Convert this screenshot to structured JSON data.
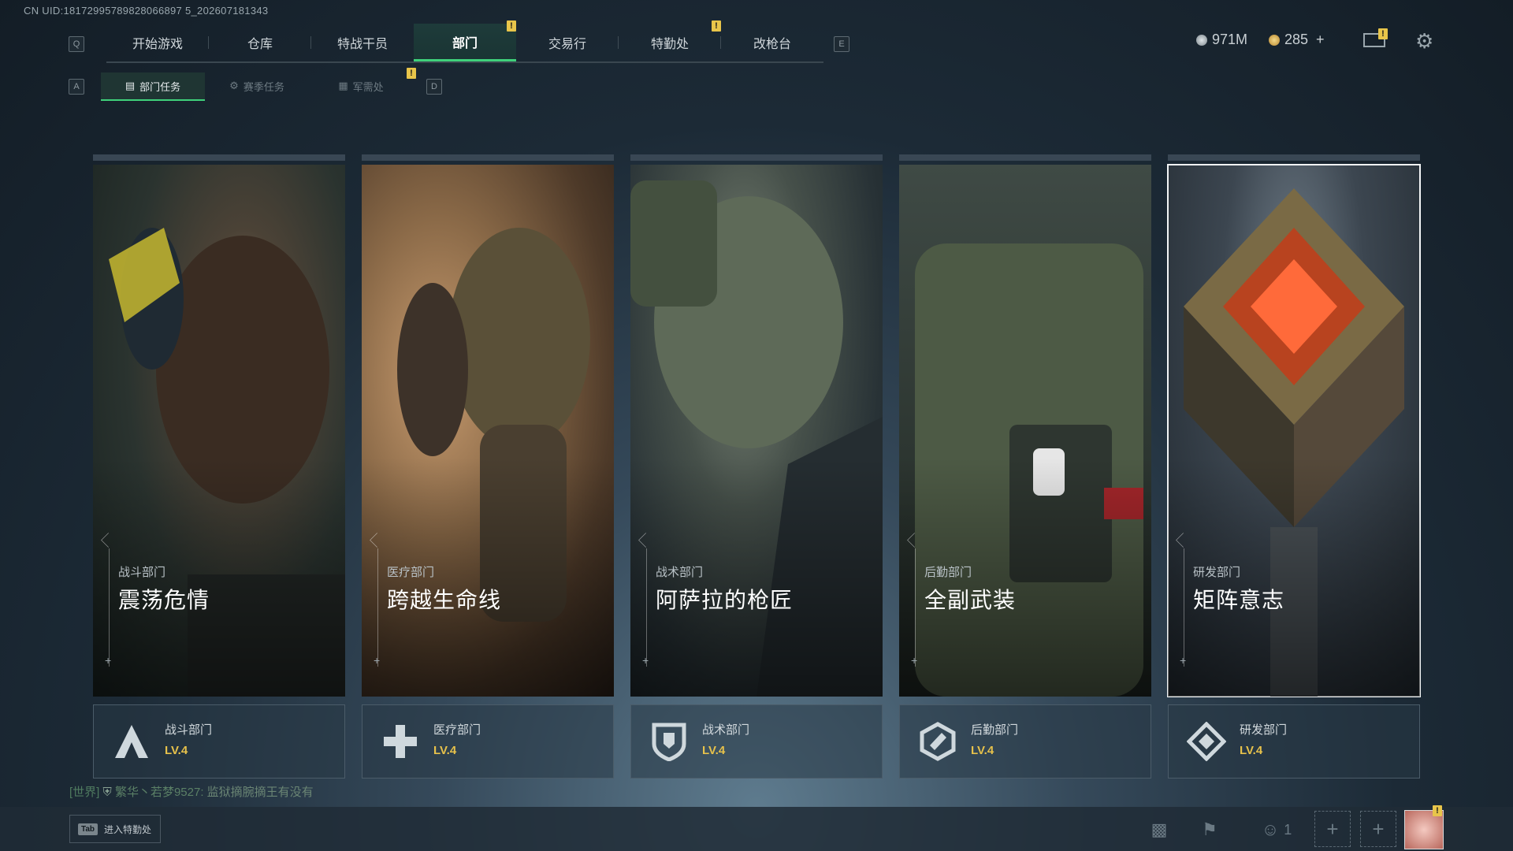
{
  "uid": "CN UID:18172995789828066897 5_202607181343",
  "nav": {
    "left_key": "Q",
    "right_key": "E",
    "tabs": [
      "开始游戏",
      "仓库",
      "特战干员",
      "部门",
      "交易行",
      "特勤处",
      "改枪台"
    ],
    "active": "部门",
    "badge": "!"
  },
  "subnav": {
    "left_key": "A",
    "right_key": "D",
    "tabs": [
      "部门任务",
      "赛季任务",
      "军需处"
    ],
    "active": "部门任务"
  },
  "currency": {
    "silver": "971M",
    "gold": "285",
    "add_label": "+"
  },
  "cards": [
    {
      "dept": "战斗部门",
      "title": "震荡危情",
      "level": "LV.4",
      "icon": "combat-icon"
    },
    {
      "dept": "医疗部门",
      "title": "跨越生命线",
      "level": "LV.4",
      "icon": "medical-icon"
    },
    {
      "dept": "战术部门",
      "title": "阿萨拉的枪匠",
      "level": "LV.4",
      "icon": "tactical-icon"
    },
    {
      "dept": "后勤部门",
      "title": "全副武装",
      "level": "LV.4",
      "icon": "logistics-icon"
    },
    {
      "dept": "研发部门",
      "title": "矩阵意志",
      "level": "LV.4",
      "icon": "rnd-icon"
    }
  ],
  "chat": {
    "channel": "[世界]",
    "user": "繁华丶若梦9527:",
    "message": "监狱摘腕摘王有没有"
  },
  "bottom": {
    "tab_key": "Tab",
    "tab_label": "进入特勤处",
    "friends_count": "1"
  },
  "colors": {
    "accent_green": "#3fd17b",
    "level_gold": "#e6c14b",
    "badge_yellow": "#e8c54a"
  }
}
